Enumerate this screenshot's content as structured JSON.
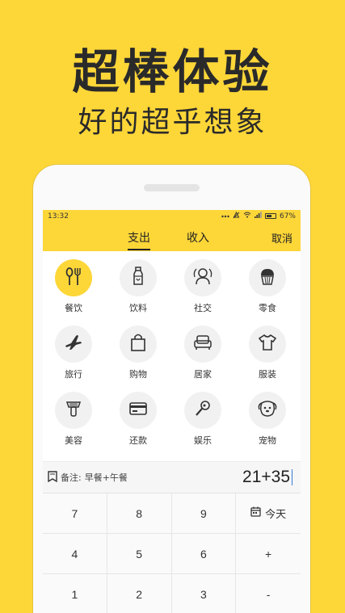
{
  "promo": {
    "headline": "超棒体验",
    "subline": "好的超乎想象"
  },
  "status_bar": {
    "time": "13:32",
    "battery": "67%"
  },
  "header": {
    "tab_expense": "支出",
    "tab_income": "收入",
    "cancel_label": "取消"
  },
  "categories": [
    {
      "label": "餐饮",
      "icon": "utensils-icon",
      "selected": true
    },
    {
      "label": "饮料",
      "icon": "bottle-icon"
    },
    {
      "label": "社交",
      "icon": "social-icon"
    },
    {
      "label": "零食",
      "icon": "cupcake-icon"
    },
    {
      "label": "旅行",
      "icon": "airplane-icon"
    },
    {
      "label": "购物",
      "icon": "shopping-bag-icon"
    },
    {
      "label": "居家",
      "icon": "armchair-icon"
    },
    {
      "label": "服装",
      "icon": "tshirt-icon"
    },
    {
      "label": "美容",
      "icon": "hairdryer-icon"
    },
    {
      "label": "还款",
      "icon": "credit-card-icon"
    },
    {
      "label": "娱乐",
      "icon": "microphone-icon"
    },
    {
      "label": "宠物",
      "icon": "dog-icon"
    }
  ],
  "note": {
    "label": "备注:",
    "text": "早餐+午餐"
  },
  "amount": "21+35",
  "keypad": {
    "k7": "7",
    "k8": "8",
    "k9": "9",
    "today": "今天",
    "k4": "4",
    "k5": "5",
    "k6": "6",
    "plus": "+",
    "k1": "1",
    "k2": "2",
    "k3": "3",
    "minus": "-"
  },
  "colors": {
    "accent": "#FDD638",
    "icon_bg": "#f1f1f1",
    "text": "#222222"
  }
}
